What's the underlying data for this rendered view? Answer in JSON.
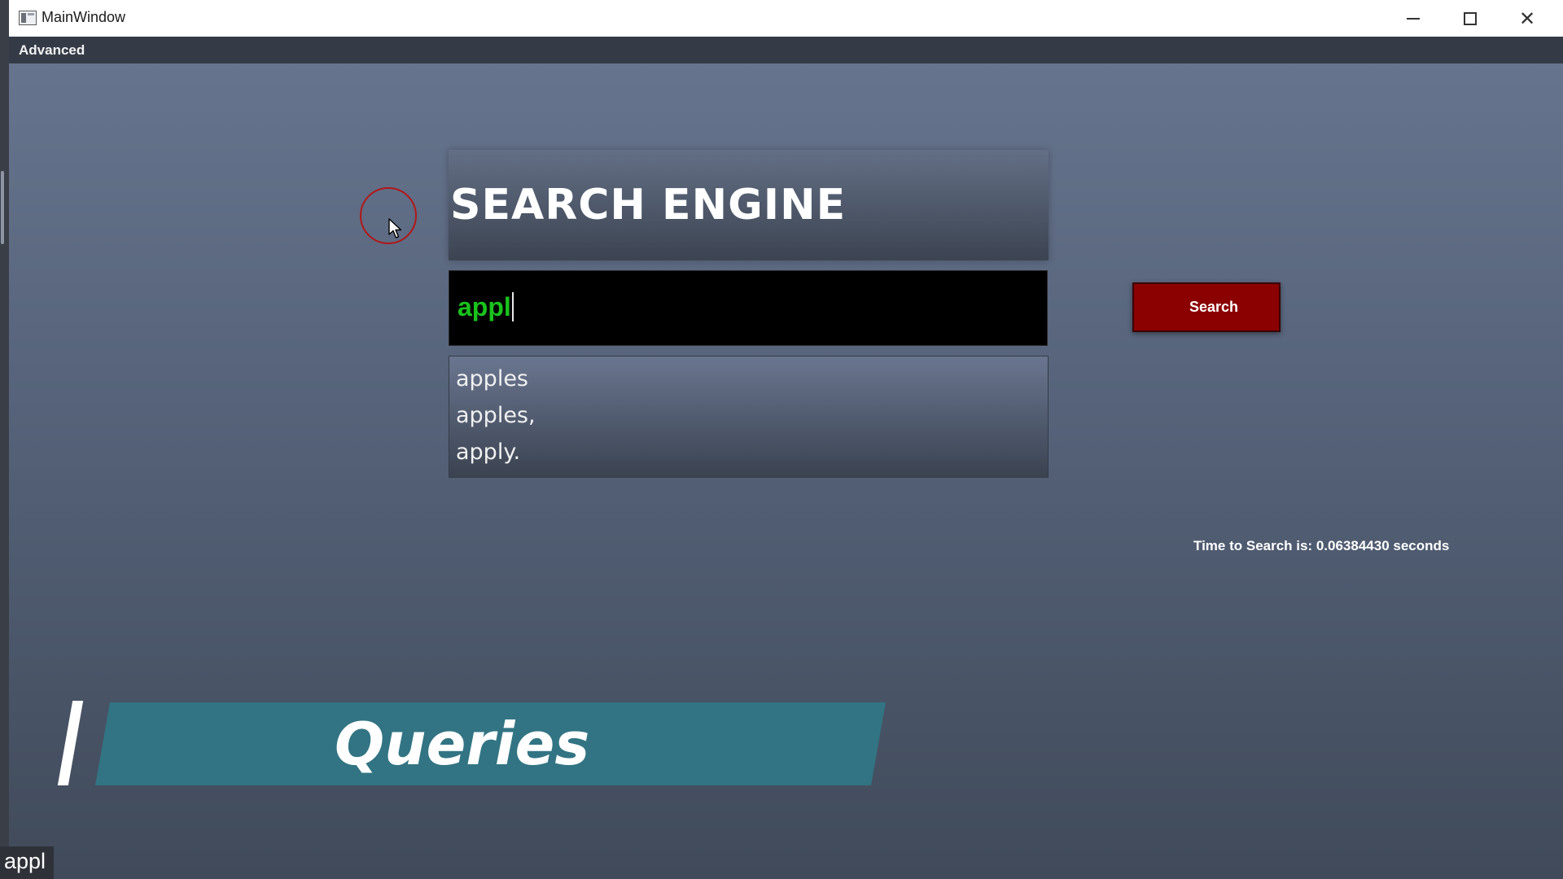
{
  "window": {
    "title": "MainWindow",
    "controls": [
      "minimize-icon",
      "maximize-icon",
      "close-icon"
    ]
  },
  "menu": {
    "items": [
      "Advanced"
    ]
  },
  "header": {
    "title": "SEARCH ENGINE"
  },
  "search": {
    "value": "appl",
    "button_label": "Search"
  },
  "suggestions": [
    "apples",
    "apples,",
    "apply."
  ],
  "stats": {
    "time_text": "Time to Search is: 0.06384430 seconds"
  },
  "banner": {
    "text": "Queries"
  },
  "overlay": {
    "caption": "appl"
  },
  "colors": {
    "input_text": "#19c31c",
    "button_bg": "#8b0000",
    "banner_bg": "#327483"
  }
}
